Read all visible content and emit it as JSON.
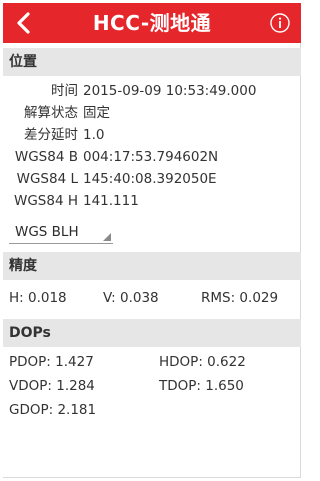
{
  "titlebar": {
    "title": "HCC-测地通",
    "back_icon": "back-arrow-icon",
    "info_icon": "info-icon",
    "color": "#e5262a"
  },
  "position": {
    "header": "位置",
    "rows": [
      {
        "label": "时间",
        "value": "2015-09-09 10:53:49.000"
      },
      {
        "label": "解算状态",
        "value": "固定"
      },
      {
        "label": "差分延时",
        "value": "1.0"
      },
      {
        "label": "WGS84 B",
        "value": "004:17:53.794602N"
      },
      {
        "label": "WGS84 L",
        "value": "145:40:08.392050E"
      },
      {
        "label": "WGS84 H",
        "value": "141.111"
      }
    ],
    "coord_system": "WGS BLH"
  },
  "precision": {
    "header": "精度",
    "h": "H: 0.018",
    "v": "V: 0.038",
    "rms": "RMS: 0.029"
  },
  "dops": {
    "header": "DOPs",
    "pdop": "PDOP: 1.427",
    "hdop": "HDOP: 0.622",
    "vdop": "VDOP: 1.284",
    "tdop": "TDOP: 1.650",
    "gdop": "GDOP: 2.181"
  }
}
